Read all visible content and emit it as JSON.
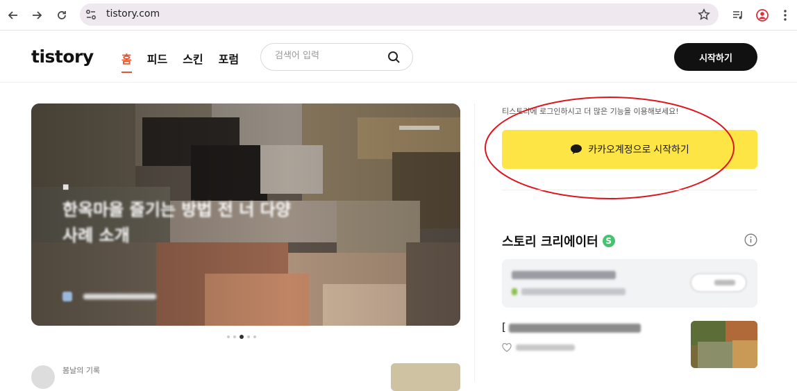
{
  "browser": {
    "url": "tistory.com"
  },
  "header": {
    "logo": "tistory",
    "nav": [
      "홈",
      "피드",
      "스킨",
      "포럼"
    ],
    "active_nav": "홈",
    "search_placeholder": "검색어 입력",
    "start_button": "시작하기"
  },
  "hero": {
    "category": "■",
    "title": "한옥마을 즐기는 방법 전 너 다양 사례 소개",
    "author": "",
    "carousel_total": 5,
    "carousel_active": 3
  },
  "sidebar": {
    "login_note": "티스토리에 로그인하시고 더 많은 기능을 이용해보세요!",
    "kakao_button": "카카오계정으로 시작하기",
    "creator_heading": "스토리 크리에이터",
    "creator_badge": "S",
    "post_prefix": "["
  },
  "below": {
    "label": "봄날의 기록"
  },
  "colors": {
    "accent": "#e5532d",
    "kakao": "#fee546",
    "highlight": "#e0141c",
    "badge": "#47c26e"
  }
}
